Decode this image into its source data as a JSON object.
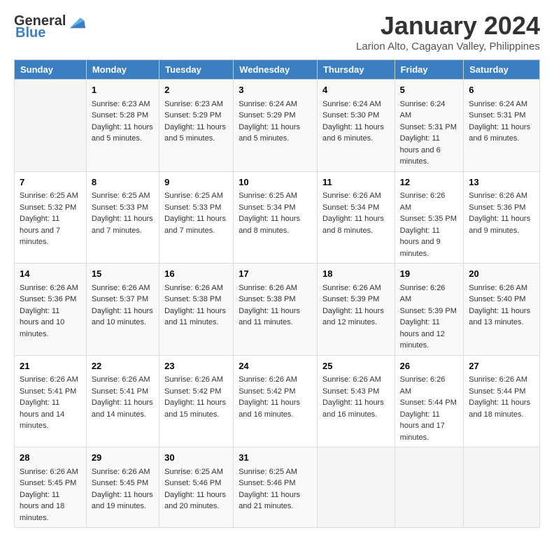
{
  "header": {
    "logo_general": "General",
    "logo_blue": "Blue",
    "month_title": "January 2024",
    "subtitle": "Larion Alto, Cagayan Valley, Philippines"
  },
  "days_of_week": [
    "Sunday",
    "Monday",
    "Tuesday",
    "Wednesday",
    "Thursday",
    "Friday",
    "Saturday"
  ],
  "weeks": [
    [
      {
        "day": "",
        "sunrise": "",
        "sunset": "",
        "daylight": ""
      },
      {
        "day": "1",
        "sunrise": "Sunrise: 6:23 AM",
        "sunset": "Sunset: 5:28 PM",
        "daylight": "Daylight: 11 hours and 5 minutes."
      },
      {
        "day": "2",
        "sunrise": "Sunrise: 6:23 AM",
        "sunset": "Sunset: 5:29 PM",
        "daylight": "Daylight: 11 hours and 5 minutes."
      },
      {
        "day": "3",
        "sunrise": "Sunrise: 6:24 AM",
        "sunset": "Sunset: 5:29 PM",
        "daylight": "Daylight: 11 hours and 5 minutes."
      },
      {
        "day": "4",
        "sunrise": "Sunrise: 6:24 AM",
        "sunset": "Sunset: 5:30 PM",
        "daylight": "Daylight: 11 hours and 6 minutes."
      },
      {
        "day": "5",
        "sunrise": "Sunrise: 6:24 AM",
        "sunset": "Sunset: 5:31 PM",
        "daylight": "Daylight: 11 hours and 6 minutes."
      },
      {
        "day": "6",
        "sunrise": "Sunrise: 6:24 AM",
        "sunset": "Sunset: 5:31 PM",
        "daylight": "Daylight: 11 hours and 6 minutes."
      }
    ],
    [
      {
        "day": "7",
        "sunrise": "Sunrise: 6:25 AM",
        "sunset": "Sunset: 5:32 PM",
        "daylight": "Daylight: 11 hours and 7 minutes."
      },
      {
        "day": "8",
        "sunrise": "Sunrise: 6:25 AM",
        "sunset": "Sunset: 5:33 PM",
        "daylight": "Daylight: 11 hours and 7 minutes."
      },
      {
        "day": "9",
        "sunrise": "Sunrise: 6:25 AM",
        "sunset": "Sunset: 5:33 PM",
        "daylight": "Daylight: 11 hours and 7 minutes."
      },
      {
        "day": "10",
        "sunrise": "Sunrise: 6:25 AM",
        "sunset": "Sunset: 5:34 PM",
        "daylight": "Daylight: 11 hours and 8 minutes."
      },
      {
        "day": "11",
        "sunrise": "Sunrise: 6:26 AM",
        "sunset": "Sunset: 5:34 PM",
        "daylight": "Daylight: 11 hours and 8 minutes."
      },
      {
        "day": "12",
        "sunrise": "Sunrise: 6:26 AM",
        "sunset": "Sunset: 5:35 PM",
        "daylight": "Daylight: 11 hours and 9 minutes."
      },
      {
        "day": "13",
        "sunrise": "Sunrise: 6:26 AM",
        "sunset": "Sunset: 5:36 PM",
        "daylight": "Daylight: 11 hours and 9 minutes."
      }
    ],
    [
      {
        "day": "14",
        "sunrise": "Sunrise: 6:26 AM",
        "sunset": "Sunset: 5:36 PM",
        "daylight": "Daylight: 11 hours and 10 minutes."
      },
      {
        "day": "15",
        "sunrise": "Sunrise: 6:26 AM",
        "sunset": "Sunset: 5:37 PM",
        "daylight": "Daylight: 11 hours and 10 minutes."
      },
      {
        "day": "16",
        "sunrise": "Sunrise: 6:26 AM",
        "sunset": "Sunset: 5:38 PM",
        "daylight": "Daylight: 11 hours and 11 minutes."
      },
      {
        "day": "17",
        "sunrise": "Sunrise: 6:26 AM",
        "sunset": "Sunset: 5:38 PM",
        "daylight": "Daylight: 11 hours and 11 minutes."
      },
      {
        "day": "18",
        "sunrise": "Sunrise: 6:26 AM",
        "sunset": "Sunset: 5:39 PM",
        "daylight": "Daylight: 11 hours and 12 minutes."
      },
      {
        "day": "19",
        "sunrise": "Sunrise: 6:26 AM",
        "sunset": "Sunset: 5:39 PM",
        "daylight": "Daylight: 11 hours and 12 minutes."
      },
      {
        "day": "20",
        "sunrise": "Sunrise: 6:26 AM",
        "sunset": "Sunset: 5:40 PM",
        "daylight": "Daylight: 11 hours and 13 minutes."
      }
    ],
    [
      {
        "day": "21",
        "sunrise": "Sunrise: 6:26 AM",
        "sunset": "Sunset: 5:41 PM",
        "daylight": "Daylight: 11 hours and 14 minutes."
      },
      {
        "day": "22",
        "sunrise": "Sunrise: 6:26 AM",
        "sunset": "Sunset: 5:41 PM",
        "daylight": "Daylight: 11 hours and 14 minutes."
      },
      {
        "day": "23",
        "sunrise": "Sunrise: 6:26 AM",
        "sunset": "Sunset: 5:42 PM",
        "daylight": "Daylight: 11 hours and 15 minutes."
      },
      {
        "day": "24",
        "sunrise": "Sunrise: 6:26 AM",
        "sunset": "Sunset: 5:42 PM",
        "daylight": "Daylight: 11 hours and 16 minutes."
      },
      {
        "day": "25",
        "sunrise": "Sunrise: 6:26 AM",
        "sunset": "Sunset: 5:43 PM",
        "daylight": "Daylight: 11 hours and 16 minutes."
      },
      {
        "day": "26",
        "sunrise": "Sunrise: 6:26 AM",
        "sunset": "Sunset: 5:44 PM",
        "daylight": "Daylight: 11 hours and 17 minutes."
      },
      {
        "day": "27",
        "sunrise": "Sunrise: 6:26 AM",
        "sunset": "Sunset: 5:44 PM",
        "daylight": "Daylight: 11 hours and 18 minutes."
      }
    ],
    [
      {
        "day": "28",
        "sunrise": "Sunrise: 6:26 AM",
        "sunset": "Sunset: 5:45 PM",
        "daylight": "Daylight: 11 hours and 18 minutes."
      },
      {
        "day": "29",
        "sunrise": "Sunrise: 6:26 AM",
        "sunset": "Sunset: 5:45 PM",
        "daylight": "Daylight: 11 hours and 19 minutes."
      },
      {
        "day": "30",
        "sunrise": "Sunrise: 6:25 AM",
        "sunset": "Sunset: 5:46 PM",
        "daylight": "Daylight: 11 hours and 20 minutes."
      },
      {
        "day": "31",
        "sunrise": "Sunrise: 6:25 AM",
        "sunset": "Sunset: 5:46 PM",
        "daylight": "Daylight: 11 hours and 21 minutes."
      },
      {
        "day": "",
        "sunrise": "",
        "sunset": "",
        "daylight": ""
      },
      {
        "day": "",
        "sunrise": "",
        "sunset": "",
        "daylight": ""
      },
      {
        "day": "",
        "sunrise": "",
        "sunset": "",
        "daylight": ""
      }
    ]
  ]
}
